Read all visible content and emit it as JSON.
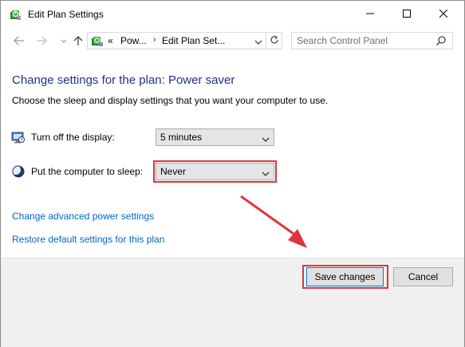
{
  "window": {
    "title": "Edit Plan Settings",
    "icon": "power-plan-icon",
    "controls": {
      "minimize": "minimize-icon",
      "maximize": "maximize-icon",
      "close": "close-icon"
    }
  },
  "nav": {
    "breadcrumb_prefix": "«",
    "breadcrumb": [
      "Pow...",
      "Edit Plan Set..."
    ],
    "search_placeholder": "Search Control Panel"
  },
  "content": {
    "heading": "Change settings for the plan: Power saver",
    "description": "Choose the sleep and display settings that you want your computer to use.",
    "settings": [
      {
        "label": "Turn off the display:",
        "value": "5 minutes",
        "icon": "monitor-icon"
      },
      {
        "label": "Put the computer to sleep:",
        "value": "Never",
        "icon": "moon-icon"
      }
    ],
    "links": [
      "Change advanced power settings",
      "Restore default settings for this plan"
    ]
  },
  "footer": {
    "save_label": "Save changes",
    "cancel_label": "Cancel"
  },
  "colors": {
    "heading": "#1e3287",
    "link": "#0066cc",
    "highlight": "#e0343c"
  }
}
